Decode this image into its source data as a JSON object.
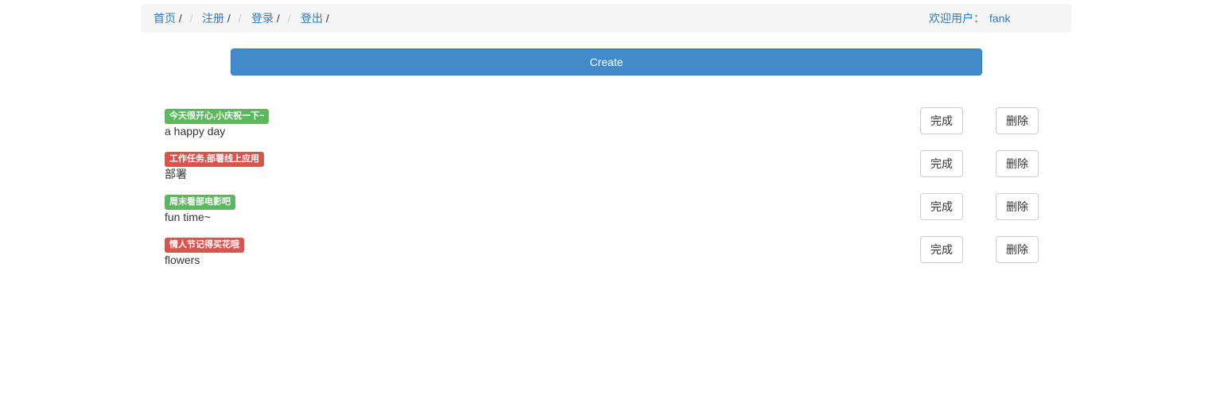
{
  "nav": {
    "items": [
      {
        "label": "首页"
      },
      {
        "label": "注册"
      },
      {
        "label": "登录"
      },
      {
        "label": "登出"
      }
    ],
    "separator": "/",
    "welcome_label": "欢迎用户：",
    "username": "fank"
  },
  "create_button": {
    "label": "Create"
  },
  "todos": [
    {
      "tag": "今天很开心,小庆祝一下~",
      "tag_color": "#5cb85c",
      "text": "a happy day",
      "done_label": "完成",
      "delete_label": "删除"
    },
    {
      "tag": "工作任务,部署线上应用",
      "tag_color": "#d9534f",
      "text": "部署",
      "done_label": "完成",
      "delete_label": "删除"
    },
    {
      "tag": "周末看部电影吧",
      "tag_color": "#5cb85c",
      "text": "fun time~",
      "done_label": "完成",
      "delete_label": "删除"
    },
    {
      "tag": "情人节记得买花哦",
      "tag_color": "#d9534f",
      "text": "flowers",
      "done_label": "完成",
      "delete_label": "删除"
    }
  ],
  "colors": {
    "link": "#337ab7",
    "primary": "#428bca",
    "success": "#5cb85c",
    "danger": "#d9534f",
    "nav_bg": "#f5f5f5"
  }
}
